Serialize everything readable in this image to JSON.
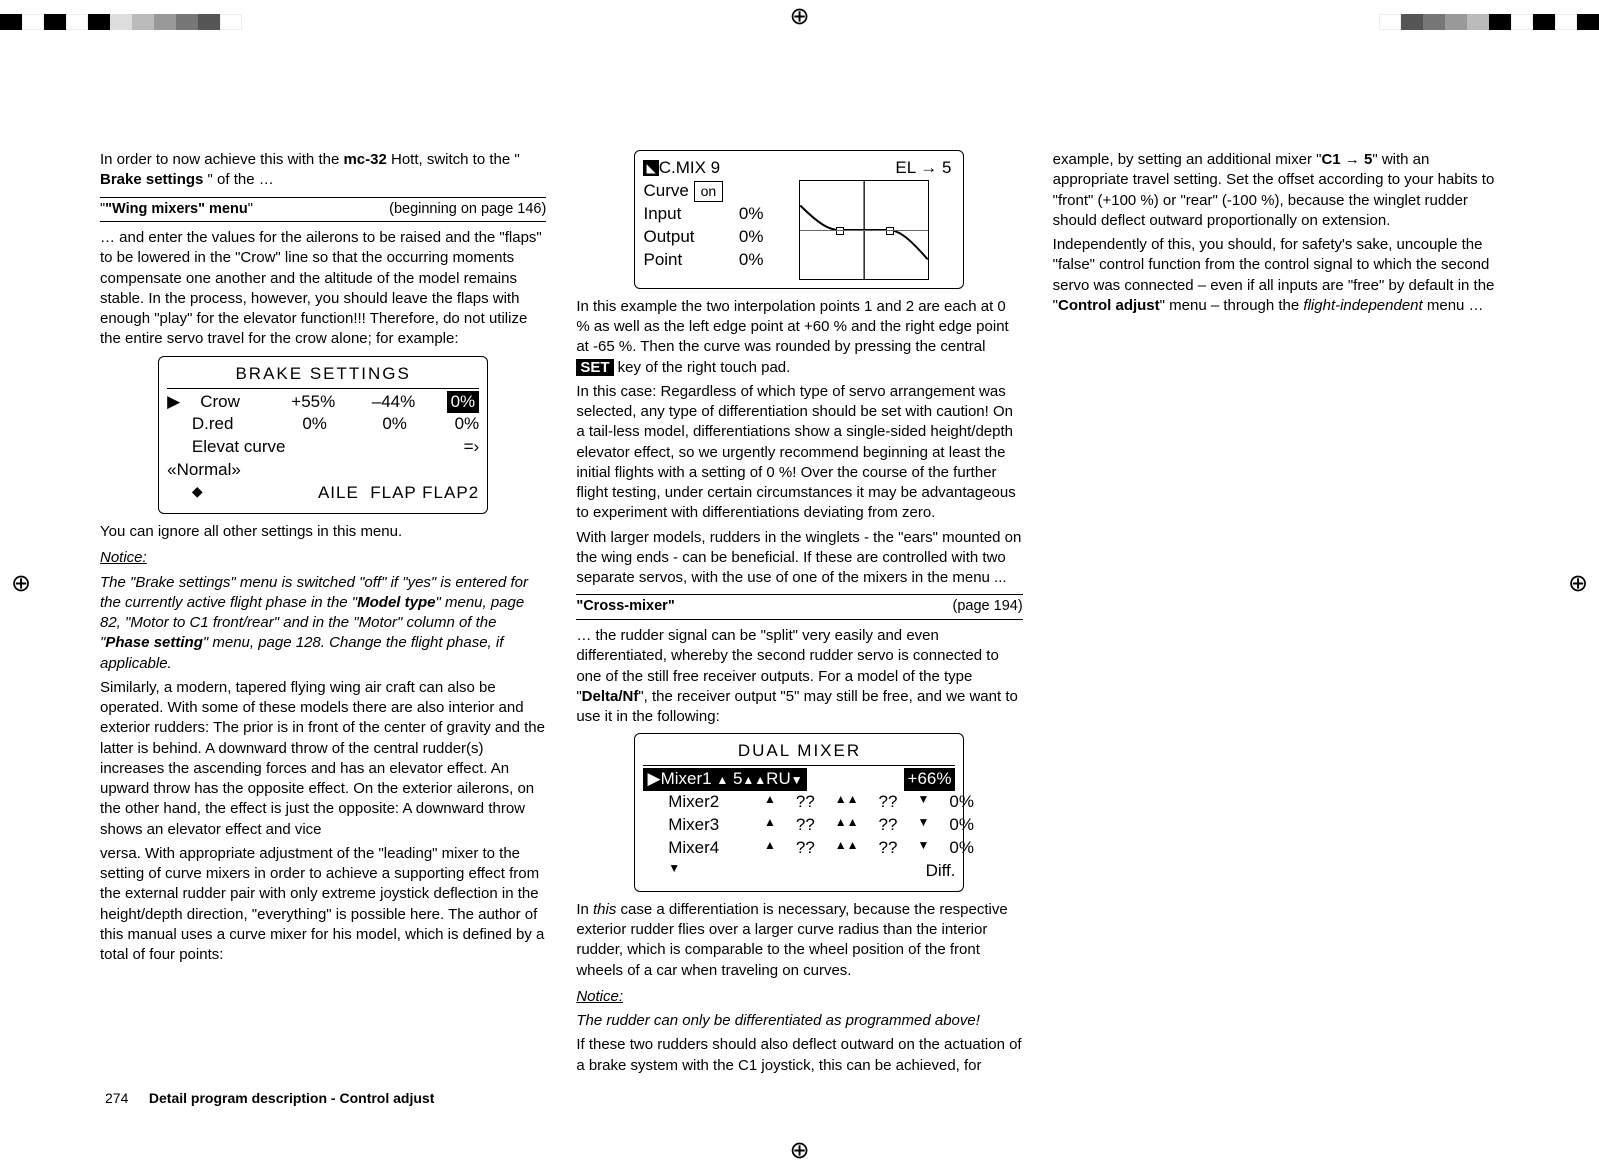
{
  "col1": {
    "intro_1": "In order to now achieve this with the ",
    "intro_mc32": "mc-32",
    "intro_2": " Hott, switch to the \"",
    "intro_brake": "Brake settings",
    "intro_3": "\" of the …",
    "wing_header_title": "\"Wing mixers\" menu",
    "wing_header_page": "(beginning on page 146)",
    "wing_p1": "… and enter the values for the ailerons to be raised and the \"flaps\" to be lowered in the \"Crow\" line so that the occurring moments compensate one another and the altitude of the model remains stable. In the process, however, you should leave the flaps with enough \"play\" for the elevator function!!! Therefore, do not utilize the entire servo travel for the crow alone; for example:",
    "brake_lcd_title": "BRAKE  SETTINGS",
    "brake_row1_label": "Crow",
    "brake_row1_a": "+55%",
    "brake_row1_b": "–44%",
    "brake_row1_c": "0%",
    "brake_row2_label": "D.red",
    "brake_row2_a": "0%",
    "brake_row2_b": "0%",
    "brake_row2_c": "0%",
    "brake_row3_label": "Elevat curve",
    "brake_row3_arrow": "=›",
    "brake_row4": "«Normal»",
    "brake_row5": "AILE  FLAP FLAP2",
    "after_brake": "You can ignore all other settings in this menu.",
    "notice_label": "Notice:",
    "notice_text_1": "The \"Brake settings\" menu is switched \"off\" if \"yes\" is entered for the currently active flight phase in the \"",
    "notice_model_type": "Model type",
    "notice_text_2": "\" menu, page 82, \"Motor to C1 front/rear\" and in the \"Motor\" column of the \"",
    "notice_phase_setting": "Phase setting",
    "notice_text_3": "\" menu, page 128. Change the flight phase, if applicable.",
    "similarly": "Similarly, a modern, tapered flying wing air craft can also be operated. With some of these models there are also interior and exterior rudders: The prior is in front of the center of gravity and the latter is behind. A downward throw of the central rudder(s) increases the ascending forces and has an elevator effect. An upward throw has the opposite effect. On the exterior ailerons, on the other hand, the effect is just the opposite: A downward throw shows an elevator effect and vice "
  },
  "col2": {
    "versa": "versa. With appropriate adjustment of the \"leading\" mixer to the setting of curve mixers in order to achieve a supporting effect from the external rudder pair with only extreme joystick deflection in the height/depth direction, \"everything\" is possible here. The author of this manual uses a curve mixer for his model, which is defined by a total of four points:",
    "lcd_title_left": "C.MIX  9",
    "lcd_title_right": "EL →  5",
    "lcd_curve_label": "Curve",
    "lcd_curve_val": "on",
    "lcd_input": "Input",
    "lcd_input_val": "0%",
    "lcd_output": "Output",
    "lcd_output_val": "0%",
    "lcd_point": "Point",
    "lcd_point_val": "0%",
    "example_1": "In this example the two interpolation points 1 and 2 are each at 0 % as well as the left edge point at +60 % and the right edge point at -65 %. Then the curve was rounded by pressing the central ",
    "set_key": "SET",
    "example_2": " key of the right touch pad.",
    "case_1": "In this case: Regardless of which type of servo arrangement was selected, any type of differentiation should be set with caution! On a tail-less model, differentiations show a single-sided height/depth elevator effect, so we urgently recommend beginning at least the initial flights with a setting of 0 %! Over the course of the further flight testing, under certain circumstances it may be advantageous to experiment with differentiations deviating from zero.",
    "case_2": "With larger models, rudders in the winglets - the \"ears\" mounted on the wing ends - can be beneficial. If these are controlled with two separate servos, with the use of one of the mixers in the menu ..."
  },
  "col3": {
    "cross_header_title": "\"Cross-mixer\"",
    "cross_header_page": "(page 194)",
    "cross_p1_a": "… the rudder signal can be \"split\" very easily and even differentiated, whereby the second rudder servo is connected to one of the still free receiver outputs. For a model of the type \"",
    "cross_p1_b": "Delta/Nf",
    "cross_p1_c": "\", the receiver output \"5\" may still be free, and we want to use it in the following:",
    "dual_title": "DUAL  MIXER",
    "r1_label": "Mixer1",
    "r1_from": "5",
    "r1_to": "RU",
    "r1_val": "+66%",
    "r2_label": "Mixer2",
    "r2_from": "??",
    "r2_to": "??",
    "r2_val": "0%",
    "r3_label": "Mixer3",
    "r3_from": "??",
    "r3_to": "??",
    "r3_val": "0%",
    "r4_label": "Mixer4",
    "r4_from": "??",
    "r4_to": "??",
    "r4_val": "0%",
    "r5_diff": "Diff.",
    "this_case_a": "In ",
    "this_case_b": "this",
    "this_case_c": " case a differentiation is necessary, because the respective exterior rudder flies over a larger curve radius than the interior rudder, which is comparable to the wheel position of the front wheels of a car when traveling on curves.",
    "notice_label": "Notice:",
    "notice_text": "The rudder can only be differentiated as programmed above!",
    "if_two_a": "If these two rudders should also deflect outward on the actuation of a brake system with the C1 joystick, this can be achieved, for  example, by setting an additional mixer \"",
    "if_two_b": "C1 → 5",
    "if_two_c": "\" with an appropriate travel setting. Set the offset according to your habits to \"front\" (+100 %) or \"rear\" (-100 %), because the winglet rudder should deflect outward proportionally on extension.",
    "indep_a": "Independently of this, you should, for safety's sake, uncouple the \"false\" control function from the control signal to which the second servo was connected – even if all inputs are \"free\" by default in the \"",
    "indep_b": "Control adjust",
    "indep_c": "\" menu – through the ",
    "indep_d": "flight-independent",
    "indep_e": " menu …"
  },
  "footer": {
    "page_no": "274",
    "title": "Detail program description - Control adjust"
  }
}
